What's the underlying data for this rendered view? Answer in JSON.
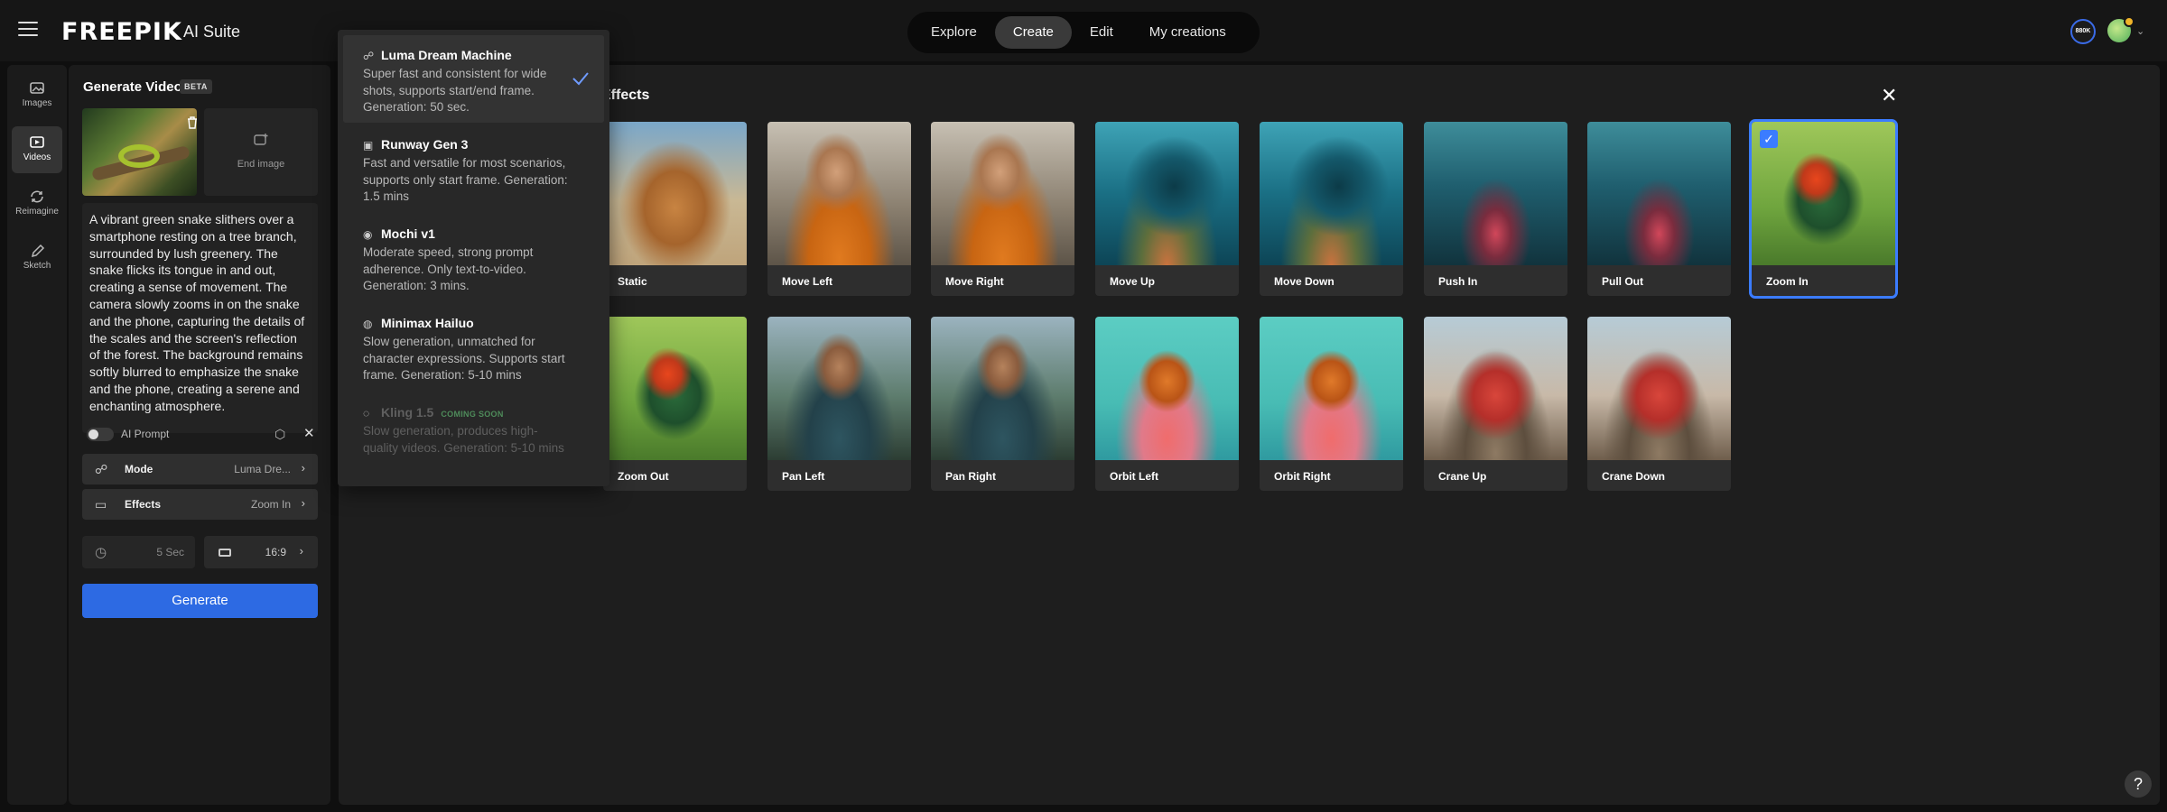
{
  "header": {
    "logo": "FREEPIK",
    "suite": "AI Suite",
    "nav": [
      "Explore",
      "Create",
      "Edit",
      "My creations"
    ],
    "active_nav": "Create",
    "credits_badge": "880K"
  },
  "rail": {
    "items": [
      {
        "label": "Images",
        "icon": "image-icon"
      },
      {
        "label": "Videos",
        "icon": "video-icon"
      },
      {
        "label": "Reimagine",
        "icon": "reimagine-icon"
      },
      {
        "label": "Sketch",
        "icon": "pencil-icon"
      }
    ],
    "active": "Videos"
  },
  "panel": {
    "title": "Generate Video",
    "beta": "BETA",
    "end_image_label": "End image",
    "prompt": "A vibrant green snake slithers over a smartphone resting on a tree branch, surrounded by lush greenery. The snake flicks its tongue in and out, creating a sense of movement. The camera slowly zooms in on the snake and the phone, capturing the details of the scales and the screen's reflection of the forest. The background remains softly blurred to emphasize the snake and the phone, creating a serene and enchanting atmosphere.",
    "ai_prompt_label": "AI Prompt",
    "mode_label": "Mode",
    "mode_value": "Luma Dre...",
    "effects_label": "Effects",
    "effects_value": "Zoom In",
    "duration": "5 Sec",
    "ratio": "16:9",
    "generate_label": "Generate"
  },
  "effects": {
    "title": "Effects",
    "selected": "Zoom In",
    "tiles": [
      {
        "label": "Static",
        "image": "dog"
      },
      {
        "label": "Move Left",
        "image": "woman"
      },
      {
        "label": "Move Right",
        "image": "woman"
      },
      {
        "label": "Move Up",
        "image": "mermaid"
      },
      {
        "label": "Move Down",
        "image": "mermaid"
      },
      {
        "label": "Push In",
        "image": "city"
      },
      {
        "label": "Pull Out",
        "image": "city"
      },
      {
        "label": "Zoom In",
        "image": "parrot"
      },
      {
        "label": "Zoom Out",
        "image": "parrot"
      },
      {
        "label": "Pan Left",
        "image": "warrior"
      },
      {
        "label": "Pan Right",
        "image": "warrior"
      },
      {
        "label": "Orbit Left",
        "image": "perfume"
      },
      {
        "label": "Orbit Right",
        "image": "perfume"
      },
      {
        "label": "Crane Up",
        "image": "diner"
      },
      {
        "label": "Crane Down",
        "image": "diner"
      }
    ]
  },
  "mode_dropdown": {
    "options": [
      {
        "title": "Luma Dream Machine",
        "desc": "Super fast and consistent for wide shots, supports start/end frame. Generation: 50 sec.",
        "selected": true,
        "disabled": false
      },
      {
        "title": "Runway Gen 3",
        "desc": "Fast and versatile for most scenarios, supports only start frame. Generation: 1.5 mins",
        "selected": false,
        "disabled": false
      },
      {
        "title": "Mochi v1",
        "desc": "Moderate speed, strong prompt adherence. Only text-to-video. Generation: 3 mins.",
        "selected": false,
        "disabled": false
      },
      {
        "title": "Minimax Hailuo",
        "desc": "Slow generation, unmatched for character expressions. Supports start frame. Generation: 5-10 mins",
        "selected": false,
        "disabled": false
      },
      {
        "title": "Kling 1.5",
        "badge": "COMING SOON",
        "desc": "Slow generation, produces high-quality videos. Generation: 5-10 mins",
        "selected": false,
        "disabled": true
      }
    ]
  },
  "colors": {
    "accent": "#2d6ae3",
    "selected_outline": "#3b7cff"
  }
}
